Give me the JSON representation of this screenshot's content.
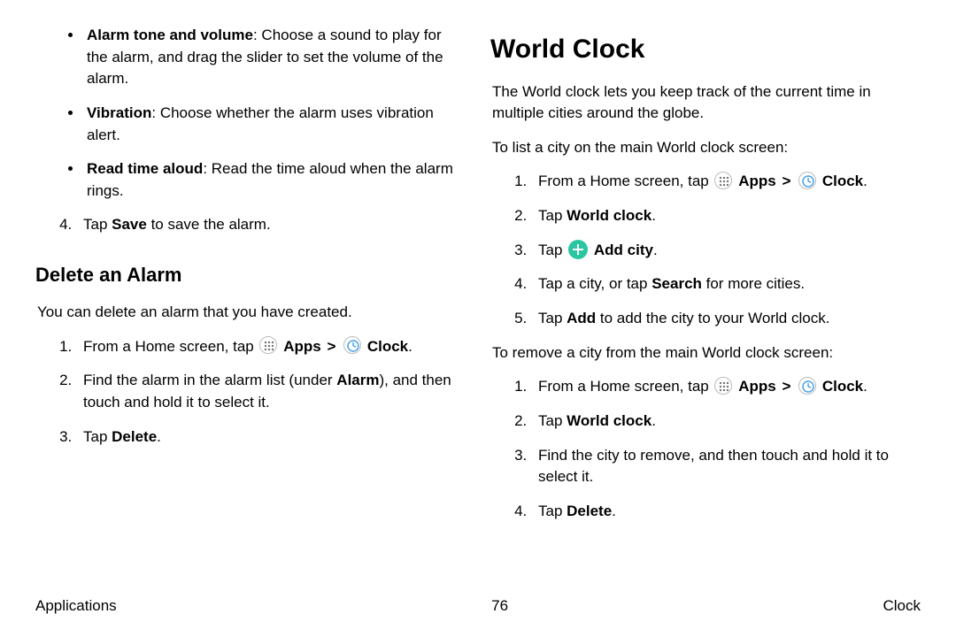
{
  "left": {
    "bullets": [
      {
        "bold": "Alarm tone and volume",
        "rest": ": Choose a sound to play for the alarm, and drag the slider to set the volume of the alarm."
      },
      {
        "bold": "Vibration",
        "rest": ": Choose whether the alarm uses vibration alert."
      },
      {
        "bold": "Read time aloud",
        "rest": ": Read the time aloud when the alarm rings."
      }
    ],
    "step4_pre": "Tap ",
    "step4_bold": "Save",
    "step4_post": " to save the alarm.",
    "delete_heading": "Delete an Alarm",
    "delete_intro": "You can delete an alarm that you have created.",
    "del1_pre": "From a Home screen, tap ",
    "apps_label": "Apps",
    "clock_label": "Clock",
    "del2_pre": "Find the alarm in the alarm list (under ",
    "del2_bold": "Alarm",
    "del2_post": "), and then touch and hold it to select it.",
    "del3_pre": "Tap ",
    "del3_bold": "Delete",
    "del3_post": "."
  },
  "right": {
    "heading": "World Clock",
    "intro": "The World clock lets you keep track of the current time in multiple cities around the globe.",
    "list_intro": "To list a city on the main World clock screen:",
    "r1_pre": "From a Home screen, tap ",
    "apps_label": "Apps",
    "clock_label": "Clock",
    "r2_pre": "Tap ",
    "r2_bold": "World clock",
    "r2_post": ".",
    "r3_pre": "Tap ",
    "r3_bold": "Add city",
    "r3_post": ".",
    "r4_pre": "Tap a city, or tap ",
    "r4_bold": "Search",
    "r4_post": " for more cities.",
    "r5_pre": "Tap ",
    "r5_bold": "Add",
    "r5_post": " to add the city to your World clock.",
    "remove_intro": "To remove a city from the main World clock screen:",
    "rm1_pre": "From a Home screen, tap ",
    "rm2_pre": "Tap ",
    "rm2_bold": "World clock",
    "rm2_post": ".",
    "rm3": "Find the city to remove, and then touch and hold it to select it.",
    "rm4_pre": "Tap ",
    "rm4_bold": "Delete",
    "rm4_post": "."
  },
  "footer": {
    "left": "Applications",
    "center": "76",
    "right": "Clock"
  },
  "chevron": ">"
}
